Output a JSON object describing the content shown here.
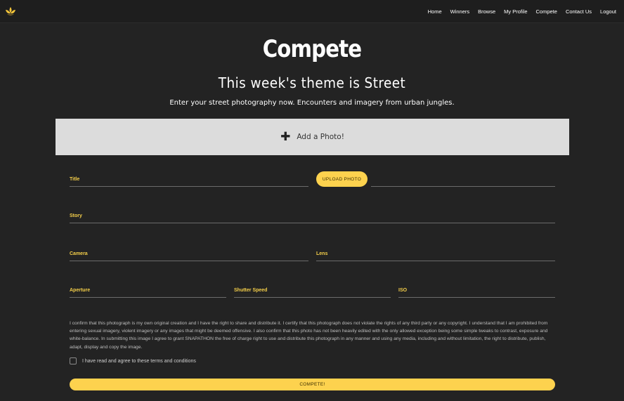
{
  "nav": {
    "logo_icon": "lotus-icon",
    "links": [
      "Home",
      "Winners",
      "Browse",
      "My Profile",
      "Compete",
      "Contact Us",
      "Logout"
    ]
  },
  "page": {
    "title": "Compete",
    "theme_line": "This week's theme is Street",
    "description": "Enter your street photography now. Encounters and imagery from urban jungles."
  },
  "add_photo": {
    "icon": "plus-icon",
    "label": "Add a Photo!"
  },
  "form": {
    "title_label": "Title",
    "upload_button": "UPLOAD PHOTO",
    "story_label": "Story",
    "camera_label": "Camera",
    "lens_label": "Lens",
    "aperture_label": "Aperture",
    "shutter_label": "Shutter Speed",
    "iso_label": "ISO",
    "terms_text": "I confirm that this photograph is my own original creation and I have the right to share and distribute it. I certify that this photograph does not violate the rights of any third party or any copyright. I understand that I am prohibited from entering sexual imagery, violent imagery or any images that might be deemed offensive. I also confirm that this photo has not been heavily edited with the only allowed exception being some simple tweaks to contrast, exposure and white-balance. In submitting this image I agree to grant SNAPATHON the free of charge right to use and distribute this photograph in any manner and using any media, including and without limitation, the right to distribute, publish, adapt, display and copy the image.",
    "terms_checkbox_label": "I have read and agree to these terms and conditions",
    "submit_button": "COMPETE!"
  },
  "colors": {
    "background": "#232323",
    "accent": "#fdd24e",
    "label": "#f5cf4a"
  }
}
